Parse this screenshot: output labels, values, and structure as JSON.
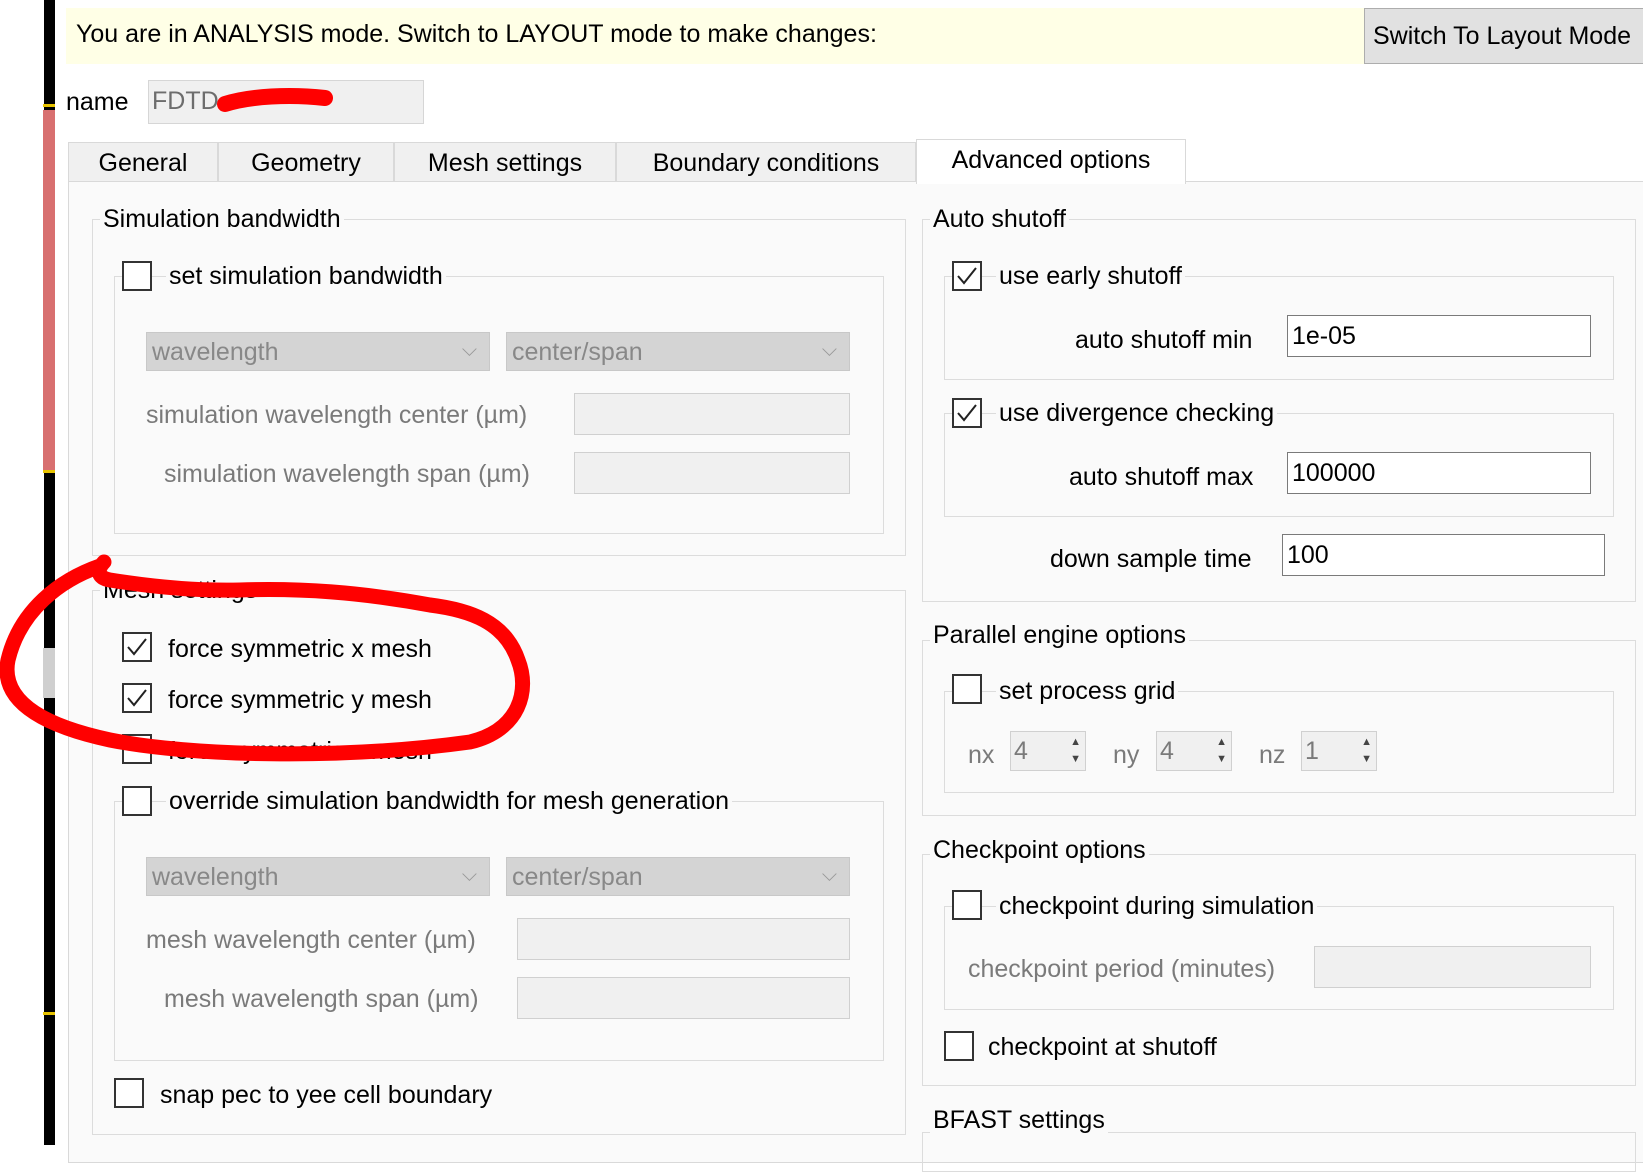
{
  "banner": {
    "message": "You are in ANALYSIS mode.  Switch to LAYOUT mode to make changes:",
    "switch_button": "Switch To Layout Mode"
  },
  "name_row": {
    "label": "name",
    "value": "FDTD"
  },
  "tabs": [
    {
      "label": "General"
    },
    {
      "label": "Geometry"
    },
    {
      "label": "Mesh settings"
    },
    {
      "label": "Boundary conditions"
    },
    {
      "label": "Advanced options",
      "active": true
    }
  ],
  "simulation_bandwidth": {
    "title": "Simulation bandwidth",
    "set_bandwidth": {
      "label": "set simulation bandwidth",
      "checked": false
    },
    "type_select": "wavelength",
    "spec_select": "center/span",
    "center_label": "simulation wavelength center (µm)",
    "span_label": "simulation wavelength span (µm)"
  },
  "mesh_settings": {
    "title": "Mesh settings",
    "force_x": {
      "label": "force symmetric x mesh",
      "checked": true
    },
    "force_y": {
      "label": "force symmetric y mesh",
      "checked": true
    },
    "force_z": {
      "label": "force symmetric z mesh",
      "checked": false
    },
    "override": {
      "label": "override simulation bandwidth for mesh generation",
      "checked": false
    },
    "type_select": "wavelength",
    "spec_select": "center/span",
    "center_label": "mesh wavelength center (µm)",
    "span_label": "mesh wavelength span (µm)",
    "snap_pec": {
      "label": "snap pec to yee cell boundary",
      "checked": false
    }
  },
  "auto_shutoff": {
    "title": "Auto shutoff",
    "early": {
      "label": "use early shutoff",
      "checked": true
    },
    "min_label": "auto shutoff min",
    "min_value": "1e-05",
    "divergence": {
      "label": "use divergence checking",
      "checked": true
    },
    "max_label": "auto shutoff max",
    "max_value": "100000",
    "down_label": "down sample time",
    "down_value": "100"
  },
  "parallel": {
    "title": "Parallel engine options",
    "process_grid": {
      "label": "set process grid",
      "checked": false
    },
    "nx_label": "nx",
    "nx_value": "4",
    "ny_label": "ny",
    "ny_value": "4",
    "nz_label": "nz",
    "nz_value": "1"
  },
  "checkpoint": {
    "title": "Checkpoint options",
    "during": {
      "label": "checkpoint during simulation",
      "checked": false
    },
    "period_label": "checkpoint period (minutes)",
    "at_shutoff": {
      "label": "checkpoint at shutoff",
      "checked": false
    }
  },
  "bfast": {
    "title": "BFAST settings"
  },
  "annotation_color": "#ff0000"
}
